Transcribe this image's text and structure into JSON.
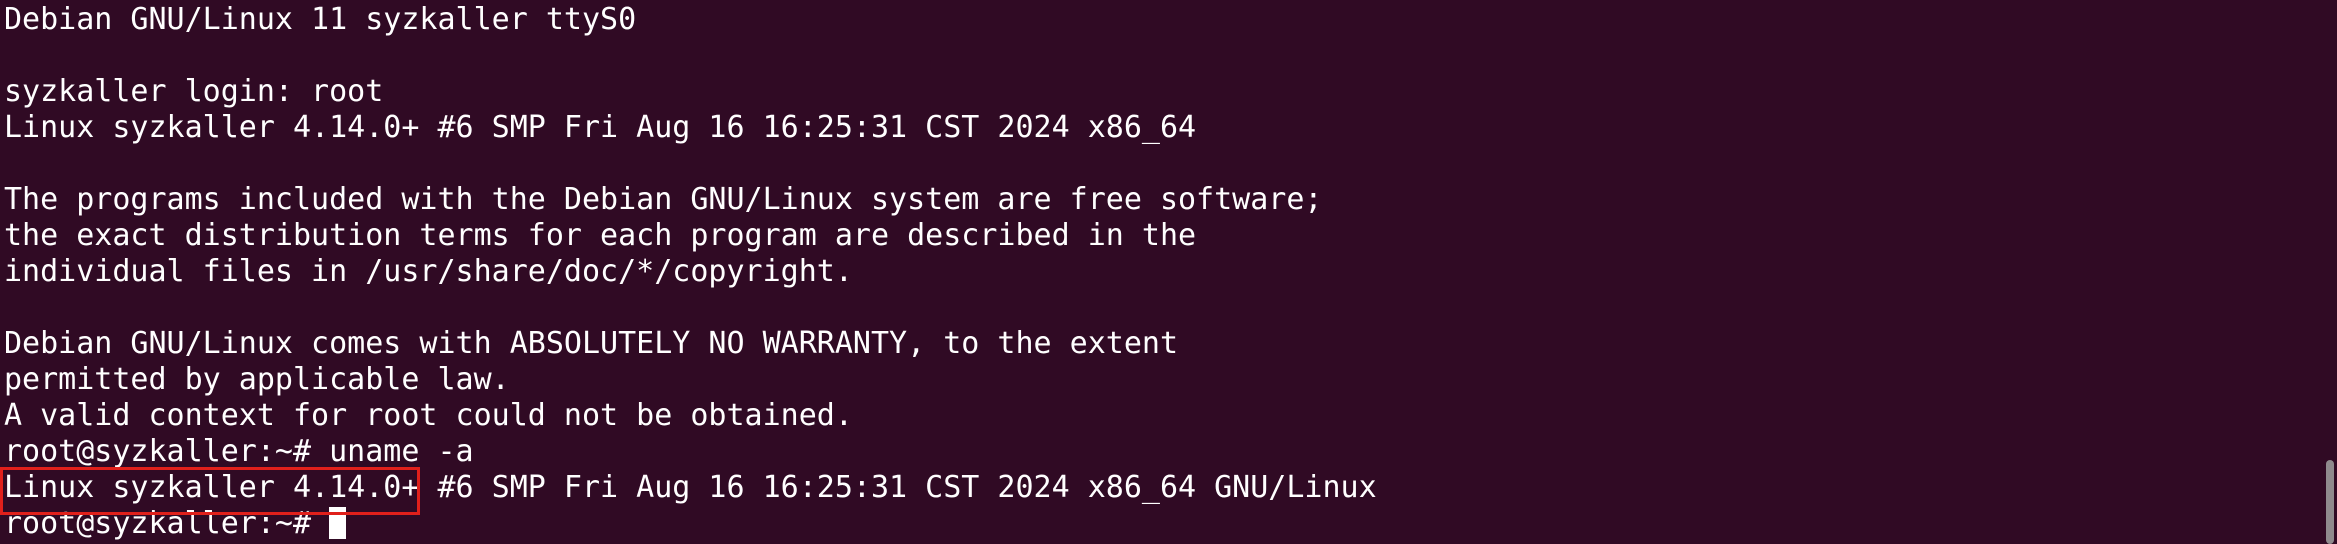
{
  "terminal": {
    "lines": [
      "Debian GNU/Linux 11 syzkaller ttyS0",
      "",
      "syzkaller login: root",
      "Linux syzkaller 4.14.0+ #6 SMP Fri Aug 16 16:25:31 CST 2024 x86_64",
      "",
      "The programs included with the Debian GNU/Linux system are free software;",
      "the exact distribution terms for each program are described in the",
      "individual files in /usr/share/doc/*/copyright.",
      "",
      "Debian GNU/Linux comes with ABSOLUTELY NO WARRANTY, to the extent",
      "permitted by applicable law.",
      "A valid context for root could not be obtained.",
      "root@syzkaller:~# uname -a",
      "Linux syzkaller 4.14.0+ #6 SMP Fri Aug 16 16:25:31 CST 2024 x86_64 GNU/Linux"
    ],
    "prompt": "root@syzkaller:~# "
  },
  "colors": {
    "background": "#300a24",
    "text": "#ffffff",
    "highlight_border": "#e0201b",
    "scrollbar_thumb": "#8f8a8d"
  }
}
